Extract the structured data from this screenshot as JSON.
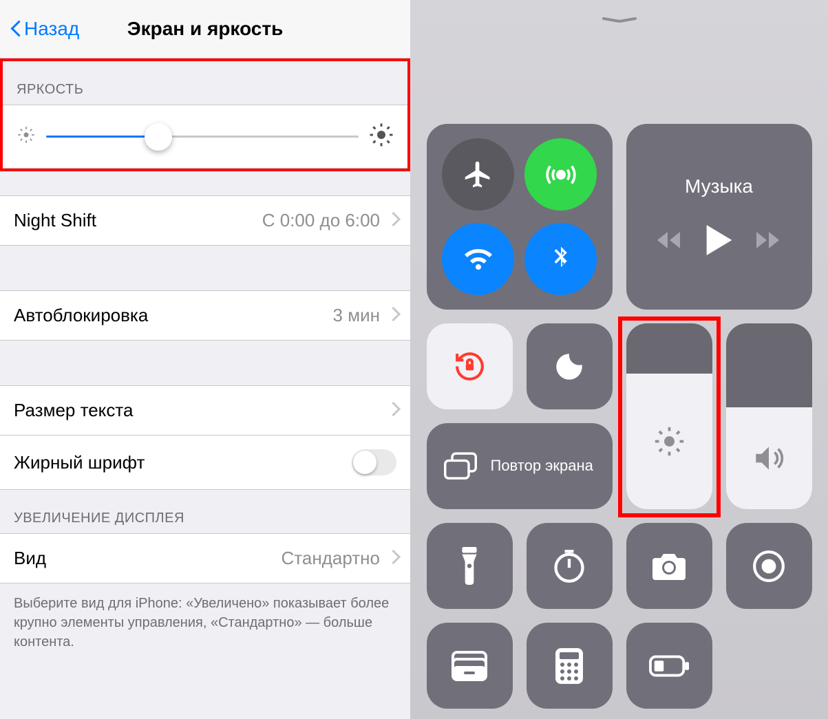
{
  "settings": {
    "back_label": "Назад",
    "title": "Экран и яркость",
    "brightness_header": "ЯРКОСТЬ",
    "brightness_value_percent": 36,
    "night_shift": {
      "label": "Night Shift",
      "value": "С 0:00 до 6:00"
    },
    "auto_lock": {
      "label": "Автоблокировка",
      "value": "3 мин"
    },
    "text_size": {
      "label": "Размер текста"
    },
    "bold_text": {
      "label": "Жирный шрифт",
      "on": false
    },
    "display_zoom_header": "УВЕЛИЧЕНИЕ ДИСПЛЕЯ",
    "view": {
      "label": "Вид",
      "value": "Стандартно"
    },
    "footer": "Выберите вид для iPhone: «Увеличено» показывает более крупно элементы управления, «Стандартно» — больше контента."
  },
  "control_center": {
    "music_label": "Музыка",
    "screen_mirror_label": "Повтор экрана",
    "brightness_percent": 73,
    "volume_percent": 55
  }
}
